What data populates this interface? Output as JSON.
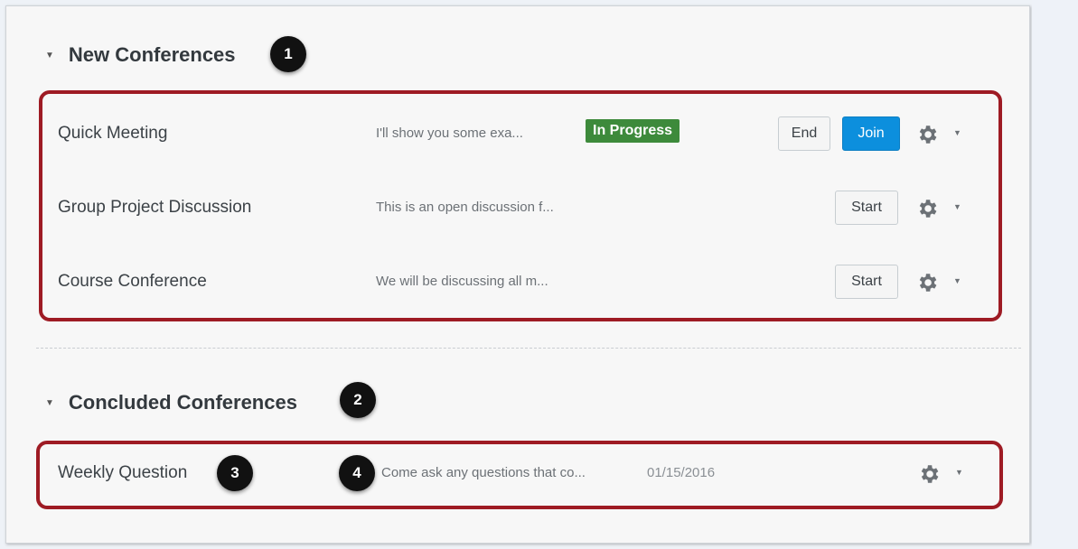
{
  "sections": {
    "new": {
      "title": "New Conferences",
      "badge": "1"
    },
    "concluded": {
      "title": "Concluded Conferences",
      "badge": "2"
    }
  },
  "new_conferences": [
    {
      "title": "Quick Meeting",
      "description": "I'll show you some exa...",
      "status": "In Progress",
      "end_label": "End",
      "join_label": "Join"
    },
    {
      "title": "Group Project Discussion",
      "description": "This is an open discussion f...",
      "start_label": "Start"
    },
    {
      "title": "Course Conference",
      "description": "We will be discussing all m...",
      "start_label": "Start"
    }
  ],
  "concluded_conferences": [
    {
      "title": "Weekly Question",
      "title_badge": "3",
      "description": "Come ask any questions that co...",
      "description_badge": "4",
      "date": "01/15/2016"
    }
  ],
  "icons": {
    "settings": "gear-icon",
    "dropdown": "caret-down-icon",
    "collapse": "caret-down-icon"
  },
  "colors": {
    "in_progress": "#3d8a3b",
    "join": "#0c8fdd",
    "highlight": "#9e1b24",
    "badge": "#111111"
  }
}
